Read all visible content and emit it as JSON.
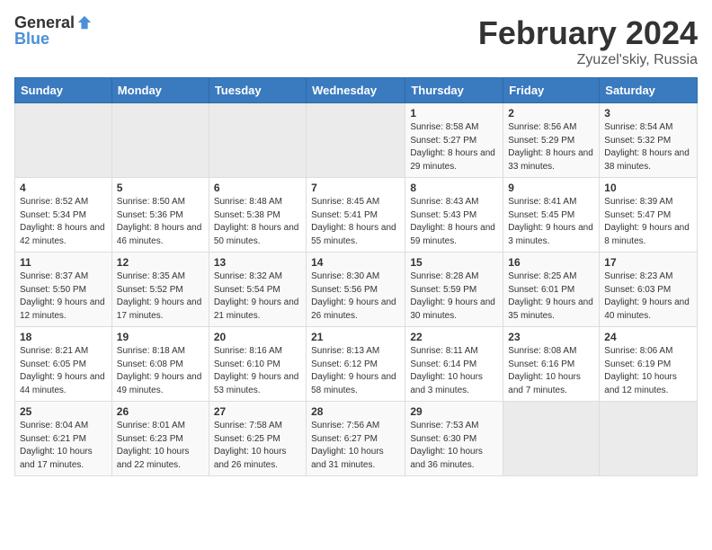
{
  "header": {
    "logo_general": "General",
    "logo_blue": "Blue",
    "title": "February 2024",
    "subtitle": "Zyuzel'skiy, Russia"
  },
  "weekdays": [
    "Sunday",
    "Monday",
    "Tuesday",
    "Wednesday",
    "Thursday",
    "Friday",
    "Saturday"
  ],
  "weeks": [
    [
      {
        "day": "",
        "sunrise": "",
        "sunset": "",
        "daylight": ""
      },
      {
        "day": "",
        "sunrise": "",
        "sunset": "",
        "daylight": ""
      },
      {
        "day": "",
        "sunrise": "",
        "sunset": "",
        "daylight": ""
      },
      {
        "day": "",
        "sunrise": "",
        "sunset": "",
        "daylight": ""
      },
      {
        "day": "1",
        "sunrise": "Sunrise: 8:58 AM",
        "sunset": "Sunset: 5:27 PM",
        "daylight": "Daylight: 8 hours and 29 minutes."
      },
      {
        "day": "2",
        "sunrise": "Sunrise: 8:56 AM",
        "sunset": "Sunset: 5:29 PM",
        "daylight": "Daylight: 8 hours and 33 minutes."
      },
      {
        "day": "3",
        "sunrise": "Sunrise: 8:54 AM",
        "sunset": "Sunset: 5:32 PM",
        "daylight": "Daylight: 8 hours and 38 minutes."
      }
    ],
    [
      {
        "day": "4",
        "sunrise": "Sunrise: 8:52 AM",
        "sunset": "Sunset: 5:34 PM",
        "daylight": "Daylight: 8 hours and 42 minutes."
      },
      {
        "day": "5",
        "sunrise": "Sunrise: 8:50 AM",
        "sunset": "Sunset: 5:36 PM",
        "daylight": "Daylight: 8 hours and 46 minutes."
      },
      {
        "day": "6",
        "sunrise": "Sunrise: 8:48 AM",
        "sunset": "Sunset: 5:38 PM",
        "daylight": "Daylight: 8 hours and 50 minutes."
      },
      {
        "day": "7",
        "sunrise": "Sunrise: 8:45 AM",
        "sunset": "Sunset: 5:41 PM",
        "daylight": "Daylight: 8 hours and 55 minutes."
      },
      {
        "day": "8",
        "sunrise": "Sunrise: 8:43 AM",
        "sunset": "Sunset: 5:43 PM",
        "daylight": "Daylight: 8 hours and 59 minutes."
      },
      {
        "day": "9",
        "sunrise": "Sunrise: 8:41 AM",
        "sunset": "Sunset: 5:45 PM",
        "daylight": "Daylight: 9 hours and 3 minutes."
      },
      {
        "day": "10",
        "sunrise": "Sunrise: 8:39 AM",
        "sunset": "Sunset: 5:47 PM",
        "daylight": "Daylight: 9 hours and 8 minutes."
      }
    ],
    [
      {
        "day": "11",
        "sunrise": "Sunrise: 8:37 AM",
        "sunset": "Sunset: 5:50 PM",
        "daylight": "Daylight: 9 hours and 12 minutes."
      },
      {
        "day": "12",
        "sunrise": "Sunrise: 8:35 AM",
        "sunset": "Sunset: 5:52 PM",
        "daylight": "Daylight: 9 hours and 17 minutes."
      },
      {
        "day": "13",
        "sunrise": "Sunrise: 8:32 AM",
        "sunset": "Sunset: 5:54 PM",
        "daylight": "Daylight: 9 hours and 21 minutes."
      },
      {
        "day": "14",
        "sunrise": "Sunrise: 8:30 AM",
        "sunset": "Sunset: 5:56 PM",
        "daylight": "Daylight: 9 hours and 26 minutes."
      },
      {
        "day": "15",
        "sunrise": "Sunrise: 8:28 AM",
        "sunset": "Sunset: 5:59 PM",
        "daylight": "Daylight: 9 hours and 30 minutes."
      },
      {
        "day": "16",
        "sunrise": "Sunrise: 8:25 AM",
        "sunset": "Sunset: 6:01 PM",
        "daylight": "Daylight: 9 hours and 35 minutes."
      },
      {
        "day": "17",
        "sunrise": "Sunrise: 8:23 AM",
        "sunset": "Sunset: 6:03 PM",
        "daylight": "Daylight: 9 hours and 40 minutes."
      }
    ],
    [
      {
        "day": "18",
        "sunrise": "Sunrise: 8:21 AM",
        "sunset": "Sunset: 6:05 PM",
        "daylight": "Daylight: 9 hours and 44 minutes."
      },
      {
        "day": "19",
        "sunrise": "Sunrise: 8:18 AM",
        "sunset": "Sunset: 6:08 PM",
        "daylight": "Daylight: 9 hours and 49 minutes."
      },
      {
        "day": "20",
        "sunrise": "Sunrise: 8:16 AM",
        "sunset": "Sunset: 6:10 PM",
        "daylight": "Daylight: 9 hours and 53 minutes."
      },
      {
        "day": "21",
        "sunrise": "Sunrise: 8:13 AM",
        "sunset": "Sunset: 6:12 PM",
        "daylight": "Daylight: 9 hours and 58 minutes."
      },
      {
        "day": "22",
        "sunrise": "Sunrise: 8:11 AM",
        "sunset": "Sunset: 6:14 PM",
        "daylight": "Daylight: 10 hours and 3 minutes."
      },
      {
        "day": "23",
        "sunrise": "Sunrise: 8:08 AM",
        "sunset": "Sunset: 6:16 PM",
        "daylight": "Daylight: 10 hours and 7 minutes."
      },
      {
        "day": "24",
        "sunrise": "Sunrise: 8:06 AM",
        "sunset": "Sunset: 6:19 PM",
        "daylight": "Daylight: 10 hours and 12 minutes."
      }
    ],
    [
      {
        "day": "25",
        "sunrise": "Sunrise: 8:04 AM",
        "sunset": "Sunset: 6:21 PM",
        "daylight": "Daylight: 10 hours and 17 minutes."
      },
      {
        "day": "26",
        "sunrise": "Sunrise: 8:01 AM",
        "sunset": "Sunset: 6:23 PM",
        "daylight": "Daylight: 10 hours and 22 minutes."
      },
      {
        "day": "27",
        "sunrise": "Sunrise: 7:58 AM",
        "sunset": "Sunset: 6:25 PM",
        "daylight": "Daylight: 10 hours and 26 minutes."
      },
      {
        "day": "28",
        "sunrise": "Sunrise: 7:56 AM",
        "sunset": "Sunset: 6:27 PM",
        "daylight": "Daylight: 10 hours and 31 minutes."
      },
      {
        "day": "29",
        "sunrise": "Sunrise: 7:53 AM",
        "sunset": "Sunset: 6:30 PM",
        "daylight": "Daylight: 10 hours and 36 minutes."
      },
      {
        "day": "",
        "sunrise": "",
        "sunset": "",
        "daylight": ""
      },
      {
        "day": "",
        "sunrise": "",
        "sunset": "",
        "daylight": ""
      }
    ]
  ]
}
